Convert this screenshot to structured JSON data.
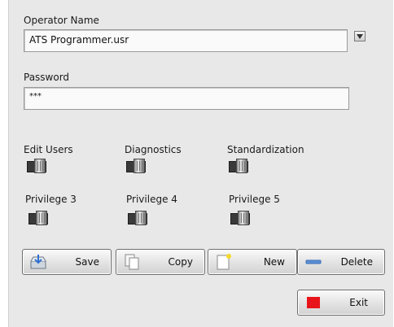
{
  "operator": {
    "label": "Operator Name",
    "value": "ATS Programmer.usr"
  },
  "password": {
    "label": "Password",
    "value": "***"
  },
  "privileges": [
    {
      "label": "Edit Users"
    },
    {
      "label": "Diagnostics"
    },
    {
      "label": "Standardization"
    },
    {
      "label": "Privilege 3"
    },
    {
      "label": "Privilege 4"
    },
    {
      "label": "Privilege 5"
    }
  ],
  "buttons": {
    "save": "Save",
    "copy": "Copy",
    "new": "New",
    "delete": "Delete",
    "exit": "Exit"
  },
  "icons": {
    "save": "save-icon",
    "copy": "copy-icon",
    "new": "new-document-icon",
    "delete": "minus-icon",
    "exit": "stop-icon",
    "dropdown": "dropdown-arrow-icon"
  },
  "colors": {
    "panel": "#e8e8e8",
    "exit_red": "#e8141a",
    "delete_blue": "#5b8fd6"
  }
}
